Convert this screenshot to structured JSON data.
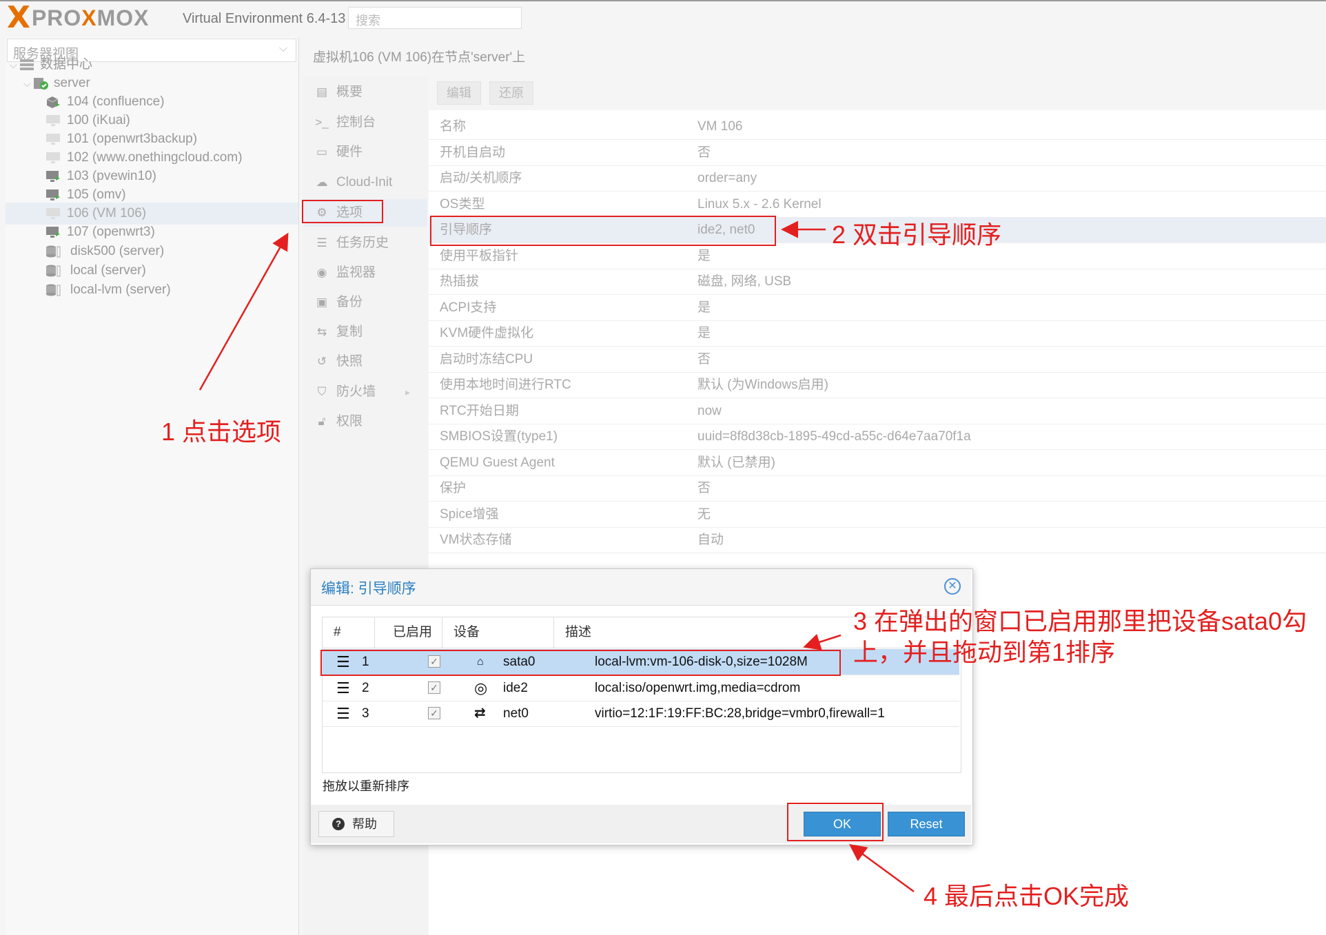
{
  "header": {
    "logo": {
      "x": "X",
      "brand_pre": "PRO",
      "brand_mid": "X",
      "brand_post": "MOX"
    },
    "version": "Virtual Environment 6.4-13",
    "search_placeholder": "搜索"
  },
  "tree": {
    "view_selector": "服务器视图",
    "items": [
      {
        "label": "数据中心",
        "icon": "datacenter-icon"
      },
      {
        "label": "server",
        "icon": "node-icon"
      },
      {
        "label": "104 (confluence)",
        "icon": "container-icon"
      },
      {
        "label": "100 (iKuai)",
        "icon": "vm-stopped-icon"
      },
      {
        "label": "101 (openwrt3backup)",
        "icon": "vm-stopped-icon"
      },
      {
        "label": "102 (www.onethingcloud.com)",
        "icon": "vm-stopped-icon"
      },
      {
        "label": "103 (pvewin10)",
        "icon": "vm-running-icon"
      },
      {
        "label": "105 (omv)",
        "icon": "vm-running-icon"
      },
      {
        "label": "106 (VM 106)",
        "icon": "vm-stopped-icon"
      },
      {
        "label": "107 (openwrt3)",
        "icon": "vm-running-icon"
      },
      {
        "label": "disk500 (server)",
        "icon": "storage-icon"
      },
      {
        "label": "local (server)",
        "icon": "storage-icon"
      },
      {
        "label": "local-lvm (server)",
        "icon": "storage-icon"
      }
    ]
  },
  "content": {
    "title": "虚拟机106 (VM 106)在节点'server'上",
    "menu": [
      {
        "label": "概要",
        "icon": "summary-icon"
      },
      {
        "label": "控制台",
        "icon": "console-icon"
      },
      {
        "label": "硬件",
        "icon": "hardware-icon"
      },
      {
        "label": "Cloud-Init",
        "icon": "cloud-icon"
      },
      {
        "label": "选项",
        "icon": "gear-icon"
      },
      {
        "label": "任务历史",
        "icon": "list-icon"
      },
      {
        "label": "监视器",
        "icon": "eye-icon"
      },
      {
        "label": "备份",
        "icon": "floppy-icon"
      },
      {
        "label": "复制",
        "icon": "retweet-icon"
      },
      {
        "label": "快照",
        "icon": "history-icon"
      },
      {
        "label": "防火墙",
        "icon": "shield-icon"
      },
      {
        "label": "权限",
        "icon": "unlock-icon"
      }
    ],
    "toolbar": {
      "edit": "编辑",
      "revert": "还原"
    },
    "options": [
      {
        "key": "名称",
        "value": "VM 106"
      },
      {
        "key": "开机自启动",
        "value": "否"
      },
      {
        "key": "启动/关机顺序",
        "value": "order=any"
      },
      {
        "key": "OS类型",
        "value": "Linux 5.x - 2.6 Kernel"
      },
      {
        "key": "引导顺序",
        "value": "ide2, net0"
      },
      {
        "key": "使用平板指针",
        "value": "是"
      },
      {
        "key": "热插拔",
        "value": "磁盘, 网络, USB"
      },
      {
        "key": "ACPI支持",
        "value": "是"
      },
      {
        "key": "KVM硬件虚拟化",
        "value": "是"
      },
      {
        "key": "启动时冻结CPU",
        "value": "否"
      },
      {
        "key": "使用本地时间进行RTC",
        "value": "默认 (为Windows启用)"
      },
      {
        "key": "RTC开始日期",
        "value": "now"
      },
      {
        "key": "SMBIOS设置(type1)",
        "value": "uuid=8f8d38cb-1895-49cd-a55c-d64e7aa70f1a"
      },
      {
        "key": "QEMU Guest Agent",
        "value": "默认 (已禁用)"
      },
      {
        "key": "保护",
        "value": "否"
      },
      {
        "key": "Spice增强",
        "value": "无"
      },
      {
        "key": "VM状态存储",
        "value": "自动"
      }
    ]
  },
  "dialog": {
    "title": "编辑: 引导顺序",
    "columns": [
      "#",
      "已启用",
      "设备",
      "描述"
    ],
    "rows": [
      {
        "num": "1",
        "device": "sata0",
        "device_icon": "hdd-icon",
        "desc": "local-lvm:vm-106-disk-0,size=1028M"
      },
      {
        "num": "2",
        "device": "ide2",
        "device_icon": "cdrom-icon",
        "desc": "local:iso/openwrt.img,media=cdrom"
      },
      {
        "num": "3",
        "device": "net0",
        "device_icon": "network-icon",
        "desc": "virtio=12:1F:19:FF:BC:28,bridge=vmbr0,firewall=1"
      }
    ],
    "drag_note": "拖放以重新排序",
    "help": "帮助",
    "ok": "OK",
    "reset": "Reset"
  },
  "annotations": {
    "step1": "1 点击选项",
    "step2": "2 双击引导顺序",
    "step3_line1": "3 在弹出的窗口已启用那里把设备sata0勾",
    "step3_line2": "上，并且拖动到第1排序",
    "step4": "4 最后点击OK完成",
    "color": "#e3201f"
  }
}
